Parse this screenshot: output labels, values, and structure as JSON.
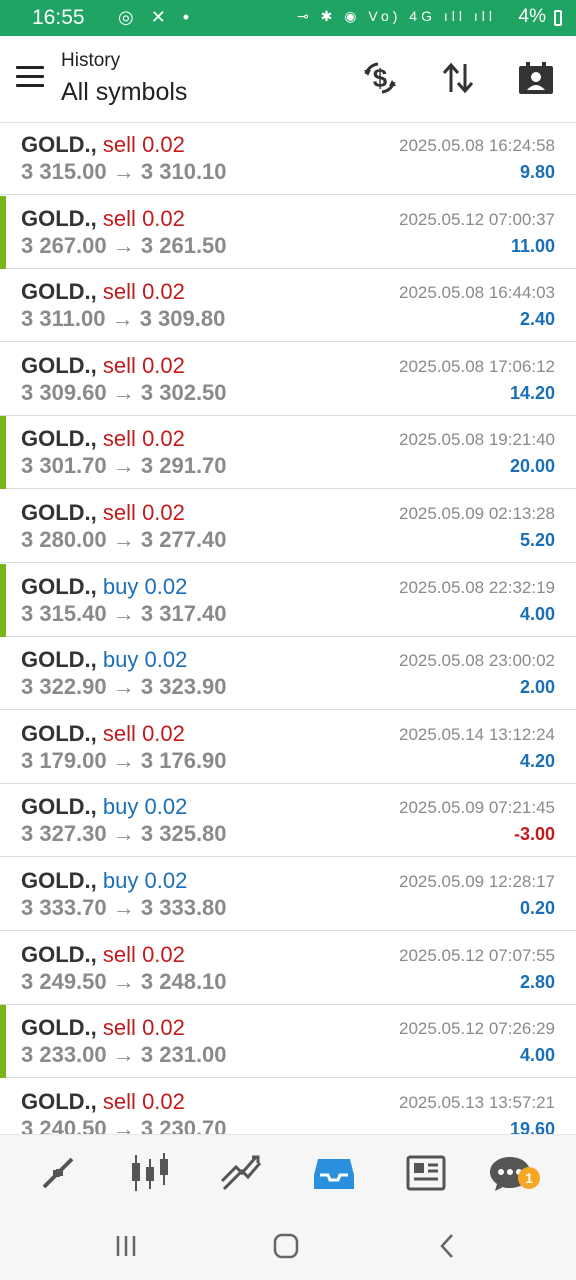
{
  "status_bar": {
    "time": "16:55",
    "left_icons": "◎ ✕ •",
    "right_icons": "⊸ ✱ ◉ Vo) 4G ıll ıll",
    "battery": "4%"
  },
  "header": {
    "title_small": "History",
    "title_big": "All symbols"
  },
  "trades": [
    {
      "symbol": "GOLD.",
      "comma": ",",
      "side": "sell",
      "volume": "0.02",
      "open": "3 315.00",
      "close": "3 310.10",
      "date": "2025.05.08 16:24:58",
      "profit": "9.80",
      "highlight": false
    },
    {
      "symbol": "GOLD.",
      "comma": ",",
      "side": "sell",
      "volume": "0.02",
      "open": "3 267.00",
      "close": "3 261.50",
      "date": "2025.05.12 07:00:37",
      "profit": "11.00",
      "highlight": true
    },
    {
      "symbol": "GOLD.",
      "comma": ",",
      "side": "sell",
      "volume": "0.02",
      "open": "3 311.00",
      "close": "3 309.80",
      "date": "2025.05.08 16:44:03",
      "profit": "2.40",
      "highlight": false
    },
    {
      "symbol": "GOLD.",
      "comma": ",",
      "side": "sell",
      "volume": "0.02",
      "open": "3 309.60",
      "close": "3 302.50",
      "date": "2025.05.08 17:06:12",
      "profit": "14.20",
      "highlight": false
    },
    {
      "symbol": "GOLD.",
      "comma": ",",
      "side": "sell",
      "volume": "0.02",
      "open": "3 301.70",
      "close": "3 291.70",
      "date": "2025.05.08 19:21:40",
      "profit": "20.00",
      "highlight": true
    },
    {
      "symbol": "GOLD.",
      "comma": ",",
      "side": "sell",
      "volume": "0.02",
      "open": "3 280.00",
      "close": "3 277.40",
      "date": "2025.05.09 02:13:28",
      "profit": "5.20",
      "highlight": false
    },
    {
      "symbol": "GOLD.",
      "comma": ",",
      "side": "buy",
      "volume": "0.02",
      "open": "3 315.40",
      "close": "3 317.40",
      "date": "2025.05.08 22:32:19",
      "profit": "4.00",
      "highlight": true
    },
    {
      "symbol": "GOLD.",
      "comma": ",",
      "side": "buy",
      "volume": "0.02",
      "open": "3 322.90",
      "close": "3 323.90",
      "date": "2025.05.08 23:00:02",
      "profit": "2.00",
      "highlight": false
    },
    {
      "symbol": "GOLD.",
      "comma": ",",
      "side": "sell",
      "volume": "0.02",
      "open": "3 179.00",
      "close": "3 176.90",
      "date": "2025.05.14 13:12:24",
      "profit": "4.20",
      "highlight": false
    },
    {
      "symbol": "GOLD.",
      "comma": ",",
      "side": "buy",
      "volume": "0.02",
      "open": "3 327.30",
      "close": "3 325.80",
      "date": "2025.05.09 07:21:45",
      "profit": "-3.00",
      "highlight": false
    },
    {
      "symbol": "GOLD.",
      "comma": ",",
      "side": "buy",
      "volume": "0.02",
      "open": "3 333.70",
      "close": "3 333.80",
      "date": "2025.05.09 12:28:17",
      "profit": "0.20",
      "highlight": false
    },
    {
      "symbol": "GOLD.",
      "comma": ",",
      "side": "sell",
      "volume": "0.02",
      "open": "3 249.50",
      "close": "3 248.10",
      "date": "2025.05.12 07:07:55",
      "profit": "2.80",
      "highlight": false
    },
    {
      "symbol": "GOLD.",
      "comma": ",",
      "side": "sell",
      "volume": "0.02",
      "open": "3 233.00",
      "close": "3 231.00",
      "date": "2025.05.12 07:26:29",
      "profit": "4.00",
      "highlight": true
    },
    {
      "symbol": "GOLD.",
      "comma": ",",
      "side": "sell",
      "volume": "0.02",
      "open": "3 240.50",
      "close": "3 230.70",
      "date": "2025.05.13 13:57:21",
      "profit": "19.60",
      "highlight": false
    }
  ],
  "arrow": "→",
  "colors": {
    "status_bar": "#1fa463",
    "sell": "#c21b1b",
    "buy": "#1a6fb8",
    "profit_positive": "#1a6fb8",
    "profit_negative": "#c21b1b",
    "highlight_marker": "#79b61a",
    "nav_active": "#2a8fdc",
    "badge": "#f5a623"
  },
  "header_icons": [
    "currency-exchange-icon",
    "sort-icon",
    "account-report-icon"
  ],
  "bottom_nav": {
    "items": [
      "quotes-icon",
      "chart-icon",
      "trade-icon",
      "history-icon",
      "news-icon",
      "messages-icon"
    ],
    "active": "history-icon",
    "messages_badge": "1"
  },
  "system_nav": [
    "recents-icon",
    "home-icon",
    "back-icon"
  ]
}
